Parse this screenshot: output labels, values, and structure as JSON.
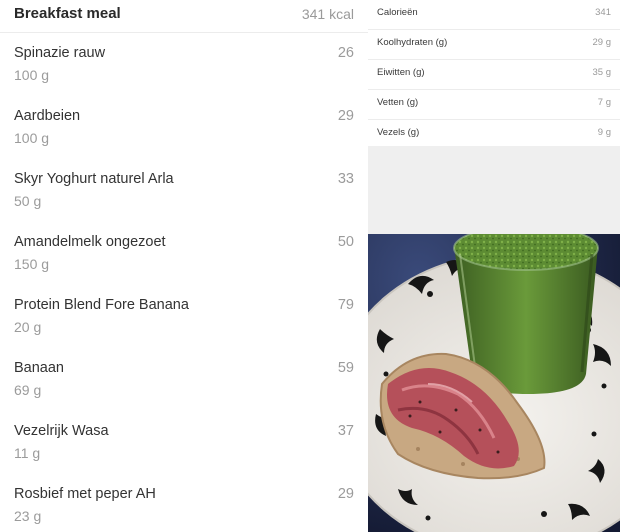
{
  "meal": {
    "title": "Breakfast meal",
    "kcal": "341 kcal",
    "items": [
      {
        "name": "Spinazie rauw",
        "amount": "100 g",
        "kcal": "26"
      },
      {
        "name": "Aardbeien",
        "amount": "100 g",
        "kcal": "29"
      },
      {
        "name": "Skyr Yoghurt naturel Arla",
        "amount": "50 g",
        "kcal": "33"
      },
      {
        "name": "Amandelmelk ongezoet",
        "amount": "150 g",
        "kcal": "50"
      },
      {
        "name": "Protein Blend Fore Banana",
        "amount": "20 g",
        "kcal": "79"
      },
      {
        "name": "Banaan",
        "amount": "69 g",
        "kcal": "59"
      },
      {
        "name": "Vezelrijk Wasa",
        "amount": "11 g",
        "kcal": "37"
      },
      {
        "name": "Rosbief met peper AH",
        "amount": "23 g",
        "kcal": "29"
      }
    ]
  },
  "nutrients": [
    {
      "label": "Calorieën",
      "value": "341"
    },
    {
      "label": "Koolhydraten (g)",
      "value": "29 g"
    },
    {
      "label": "Eiwitten (g)",
      "value": "35 g"
    },
    {
      "label": "Vetten (g)",
      "value": "7 g"
    },
    {
      "label": "Vezels (g)",
      "value": "9 g"
    }
  ],
  "colors": {
    "panel_bg": "#efefef",
    "divider": "#ececec",
    "secondary_text": "#9b9b9b",
    "smoothie_green": "#4f7a2c",
    "plate_black": "#1a1a1a",
    "beef_red": "#b5505a"
  }
}
